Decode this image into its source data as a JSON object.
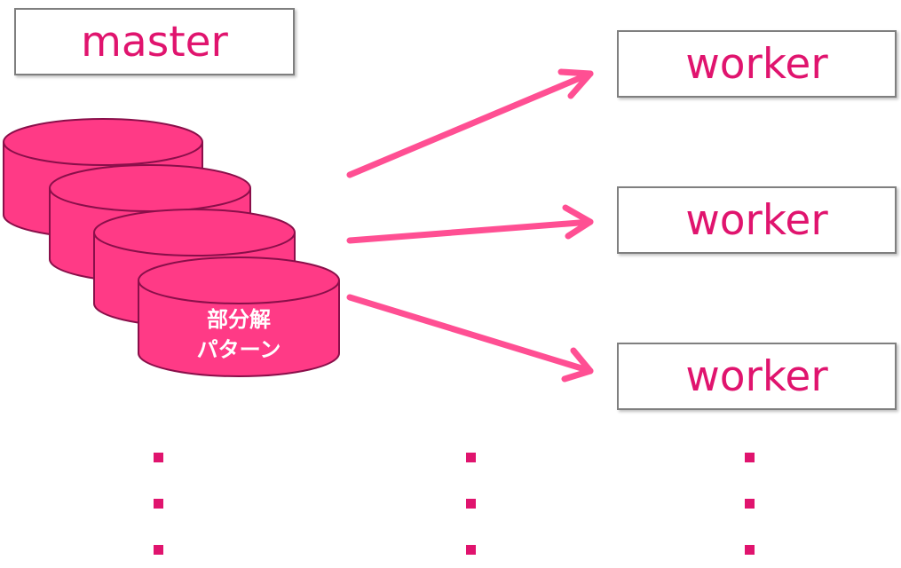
{
  "colors": {
    "accent": "#e0146e",
    "database_fill": "#ff3a86",
    "database_stroke": "#8a0f4a",
    "arrow": "#ff4f93",
    "box_border": "#7f7f7f"
  },
  "master": {
    "label": "master"
  },
  "workers": [
    {
      "label": "worker"
    },
    {
      "label": "worker"
    },
    {
      "label": "worker"
    }
  ],
  "database_stack": {
    "count": 4,
    "label_line1": "部分解",
    "label_line2": "パターン"
  },
  "continuation": {
    "icon": "vertical-ellipsis-icon"
  }
}
